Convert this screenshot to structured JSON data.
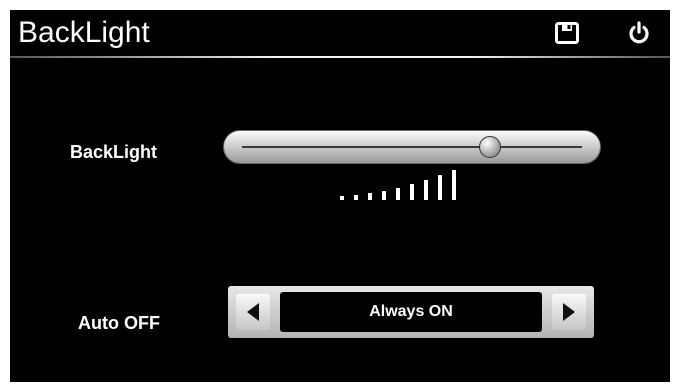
{
  "header": {
    "title": "BackLight",
    "save_icon": "save-icon",
    "power_icon": "power-icon"
  },
  "backlight": {
    "label": "BackLight",
    "level_fraction": 0.73,
    "level_bars_total": 9,
    "level_bars_active": 9
  },
  "auto_off": {
    "label": "Auto OFF",
    "value": "Always ON",
    "prev_icon": "arrow-left-icon",
    "next_icon": "arrow-right-icon"
  },
  "colors": {
    "background": "#000000",
    "text": "#ffffff",
    "control_silver": "#c6c6c6"
  }
}
